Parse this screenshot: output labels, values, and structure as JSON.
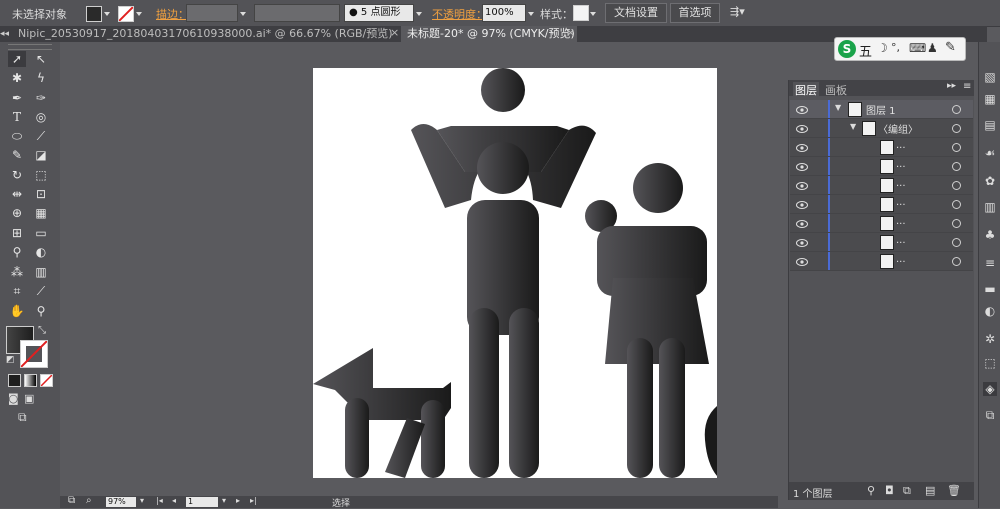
{
  "control_bar": {
    "selection_status": "未选择对象",
    "stroke_label": "描边：",
    "brush_value": "5 点圆形",
    "opacity_label": "不透明度：",
    "opacity_value": "100%",
    "style_label": "样式：",
    "doc_settings_button": "文档设置",
    "preferences_button": "首选项"
  },
  "tabs": [
    {
      "title": "Nipic_20530917_20180403170610938000.ai* @ 66.67% (RGB/预览)",
      "close": "×"
    },
    {
      "title": "未标题-20* @ 97% (CMYK/预览)",
      "close": "×"
    }
  ],
  "ime_toolbar": {
    "logo": "S",
    "label": "五"
  },
  "layers_panel": {
    "tab_layers": "图层",
    "tab_artboards": "画板",
    "rows": [
      {
        "name": "图层 1"
      },
      {
        "name": "〈编组〉"
      },
      {
        "name": "..."
      },
      {
        "name": "..."
      },
      {
        "name": "..."
      },
      {
        "name": "..."
      },
      {
        "name": "..."
      },
      {
        "name": "..."
      },
      {
        "name": "..."
      }
    ],
    "footer_count": "1 个图层"
  },
  "status_bar": {
    "zoom": "97%",
    "page": "1",
    "tool_name": "选择"
  },
  "colors": {
    "figure_dark": "#1a1a1a",
    "figure_light": "#555458",
    "layer_bar": "#4a6bd6",
    "stroke_label": "#f0a040"
  }
}
